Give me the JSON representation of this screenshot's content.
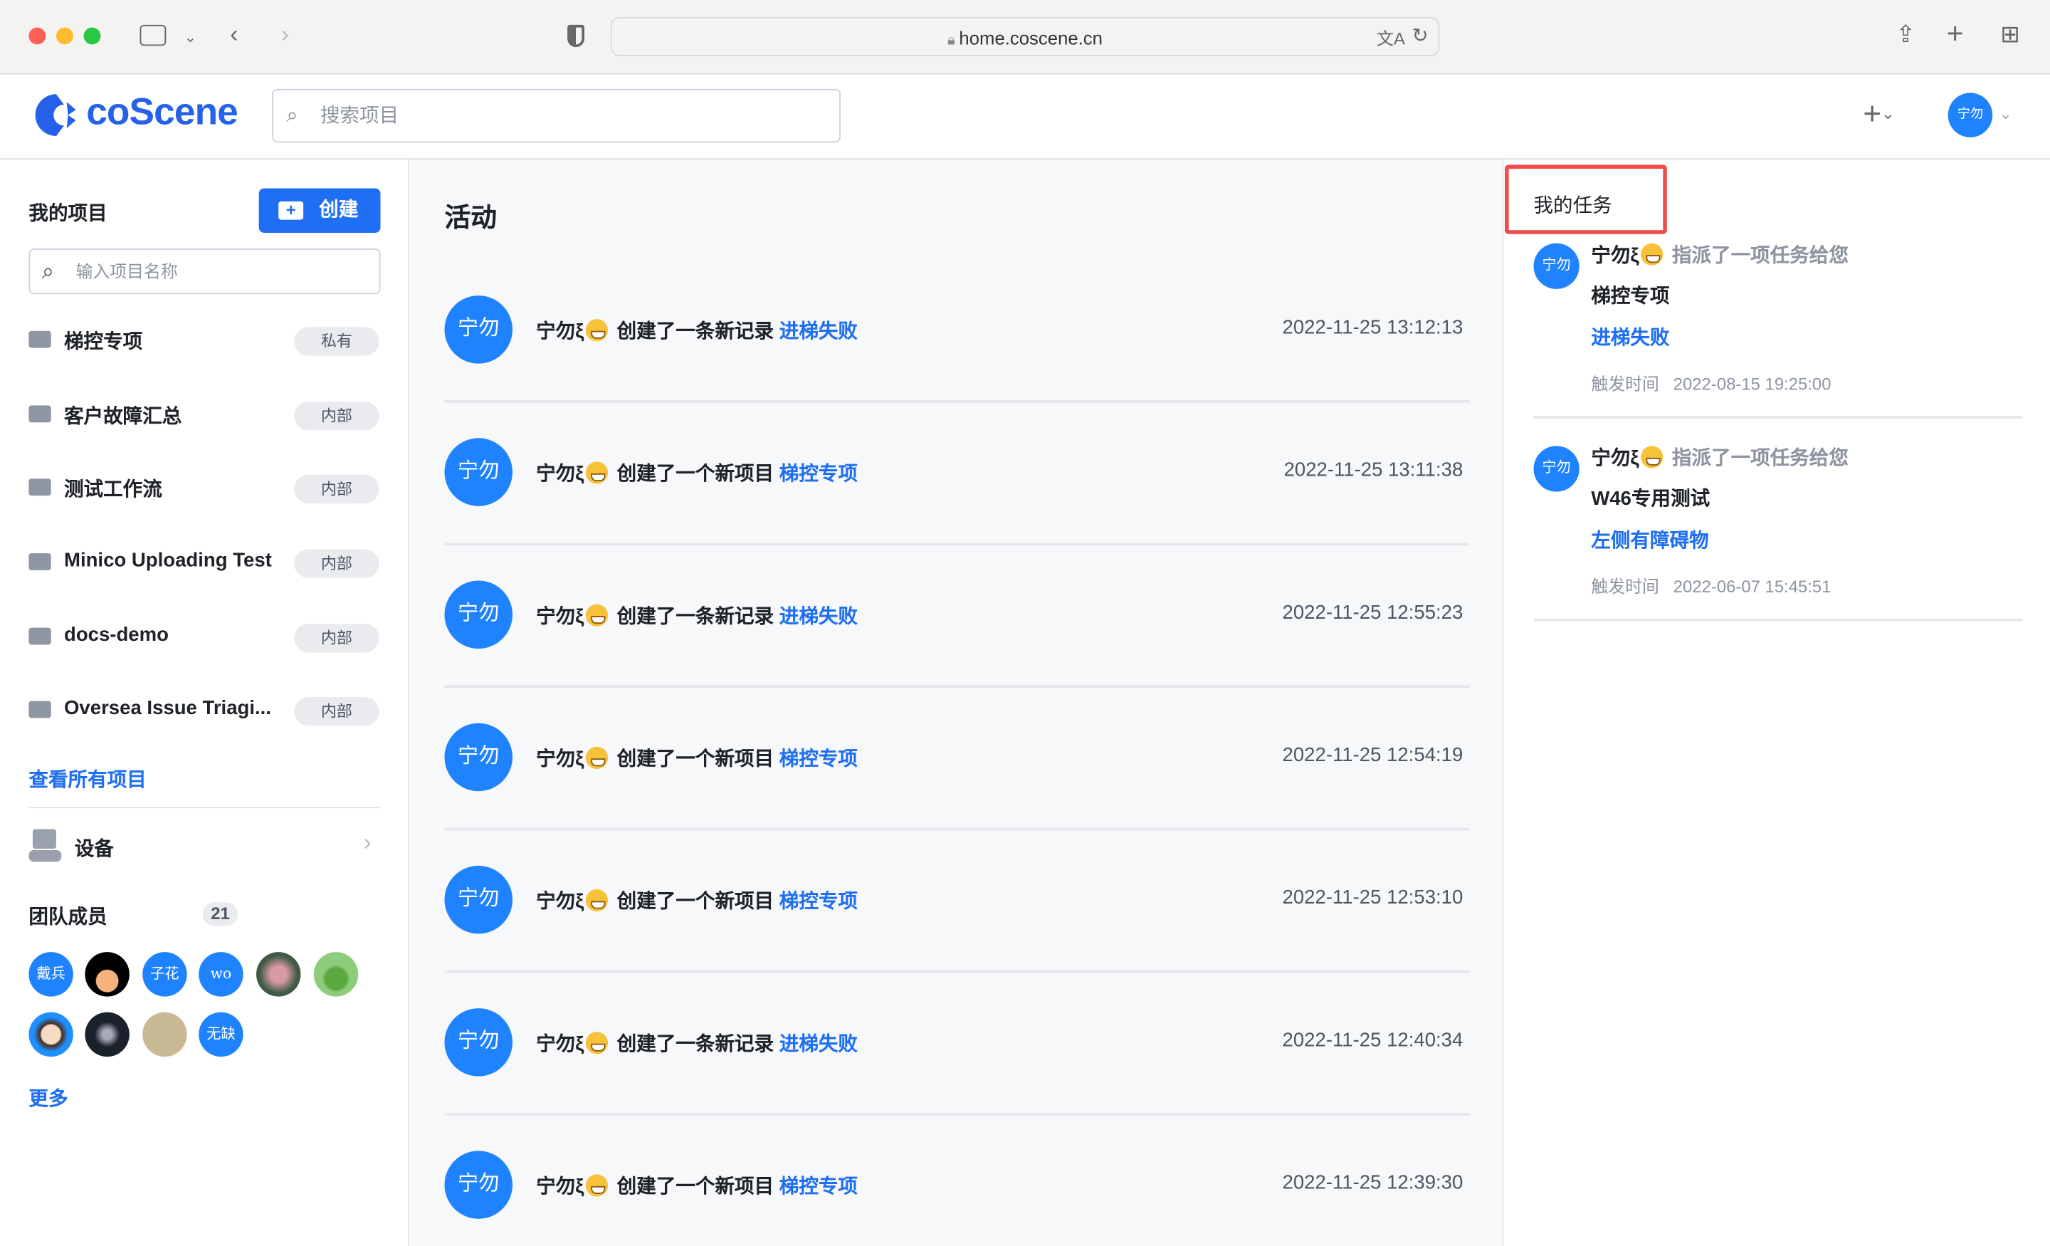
{
  "browser": {
    "url": "home.coscene.cn"
  },
  "header": {
    "logo": "coScene",
    "search_placeholder": "搜索项目",
    "user_avatar": "宁勿"
  },
  "sidebar": {
    "title": "我的项目",
    "create_label": "创建",
    "project_search_placeholder": "输入项目名称",
    "projects": [
      {
        "name": "梯控专项",
        "badge": "私有"
      },
      {
        "name": "客户故障汇总",
        "badge": "内部"
      },
      {
        "name": "测试工作流",
        "badge": "内部"
      },
      {
        "name": "Minico Uploading Test",
        "badge": "内部"
      },
      {
        "name": "docs-demo",
        "badge": "内部"
      },
      {
        "name": "Oversea Issue Triagi...",
        "badge": "内部"
      }
    ],
    "view_all": "查看所有项目",
    "devices": "设备",
    "team_title": "团队成员",
    "team_count": "21",
    "members": [
      "戴兵",
      "",
      "子花",
      "wo",
      "",
      "",
      "",
      "",
      "",
      "无缺"
    ],
    "more": "更多"
  },
  "activity": {
    "title": "活动",
    "items": [
      {
        "avatar": "宁勿",
        "user": "宁勿ξ",
        "action": "创建了一条新记录",
        "target": "进梯失败",
        "time": "2022-11-25 13:12:13"
      },
      {
        "avatar": "宁勿",
        "user": "宁勿ξ",
        "action": "创建了一个新项目",
        "target": "梯控专项",
        "time": "2022-11-25 13:11:38"
      },
      {
        "avatar": "宁勿",
        "user": "宁勿ξ",
        "action": "创建了一条新记录",
        "target": "进梯失败",
        "time": "2022-11-25 12:55:23"
      },
      {
        "avatar": "宁勿",
        "user": "宁勿ξ",
        "action": "创建了一个新项目",
        "target": "梯控专项",
        "time": "2022-11-25 12:54:19"
      },
      {
        "avatar": "宁勿",
        "user": "宁勿ξ",
        "action": "创建了一个新项目",
        "target": "梯控专项",
        "time": "2022-11-25 12:53:10"
      },
      {
        "avatar": "宁勿",
        "user": "宁勿ξ",
        "action": "创建了一条新记录",
        "target": "进梯失败",
        "time": "2022-11-25 12:40:34"
      },
      {
        "avatar": "宁勿",
        "user": "宁勿ξ",
        "action": "创建了一个新项目",
        "target": "梯控专项",
        "time": "2022-11-25 12:39:30"
      }
    ]
  },
  "tasks": {
    "title": "我的任务",
    "items": [
      {
        "avatar": "宁勿",
        "user": "宁勿ξ",
        "action": "指派了一项任务给您",
        "project": "梯控专项",
        "task": "进梯失败",
        "time_label": "触发时间",
        "time": "2022-08-15 19:25:00"
      },
      {
        "avatar": "宁勿",
        "user": "宁勿ξ",
        "action": "指派了一项任务给您",
        "project": "W46专用测试",
        "task": "左侧有障碍物",
        "time_label": "触发时间",
        "time": "2022-06-07 15:45:51"
      }
    ]
  },
  "colors": {
    "accent": "#1f6ff2",
    "avatar": "#1f83ff",
    "highlight_box": "#f04b4b"
  }
}
